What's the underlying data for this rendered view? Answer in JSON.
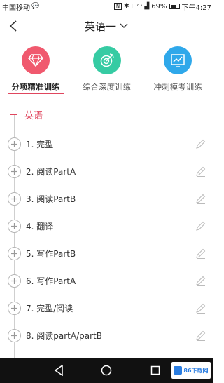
{
  "status_bar": {
    "carrier": "中国移动",
    "battery": "69%",
    "time": "下午4:27"
  },
  "header": {
    "title": "英语一"
  },
  "tabs": [
    {
      "label": "分项精准训练",
      "active": true,
      "icon": "diamond-icon",
      "color": "#f0596e"
    },
    {
      "label": "综合深度训练",
      "active": false,
      "icon": "target-icon",
      "color": "#36cba3"
    },
    {
      "label": "冲刺模考训练",
      "active": false,
      "icon": "chart-icon",
      "color": "#2fa8ea"
    }
  ],
  "tree": {
    "section_label": "英语",
    "items": [
      {
        "label": "1. 完型"
      },
      {
        "label": "2. 阅读PartA"
      },
      {
        "label": "3. 阅读PartB"
      },
      {
        "label": "4. 翻译"
      },
      {
        "label": "5. 写作PartB"
      },
      {
        "label": "6. 写作PartA"
      },
      {
        "label": "7. 完型/阅读"
      },
      {
        "label": "8. 阅读partA/partB"
      }
    ]
  },
  "watermark": {
    "text": "86下载网"
  },
  "colors": {
    "accent": "#e0465e"
  }
}
